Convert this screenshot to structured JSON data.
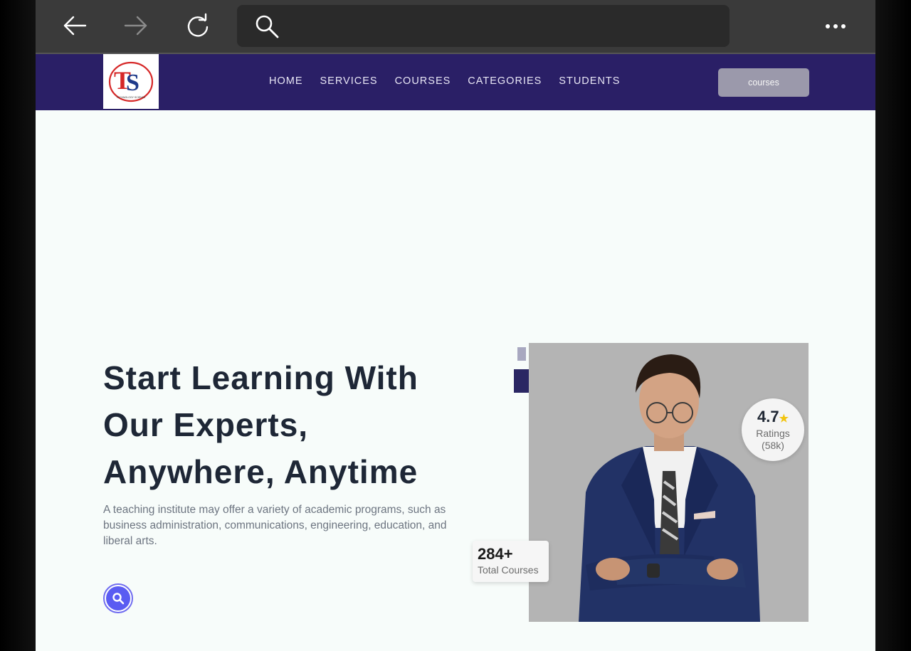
{
  "browser": {
    "back_icon": "arrow-left-icon",
    "forward_icon": "arrow-right-icon",
    "reload_icon": "reload-icon",
    "search_icon": "search-icon",
    "address_value": "",
    "more_icon": "more-horizontal-icon"
  },
  "header": {
    "logo_text": "TS",
    "logo_caption": "TECHNOLOGY SCIENCE",
    "nav": [
      "HOME",
      "SERVICES",
      "COURSES",
      "CATEGORIES",
      "STUDENTS"
    ],
    "cta_label": "courses",
    "bg_color": "#2a1f66"
  },
  "hero": {
    "title_lines": [
      "Start Learning With",
      "Our Experts,",
      "Anywhere, Anytime"
    ],
    "description": "A teaching institute may offer a variety of academic programs, such as business administration, communications, engineering, education, and liberal arts.",
    "search_button_icon": "search-icon",
    "accent_color": "#5a5cf2"
  },
  "rating_badge": {
    "score": "4.7",
    "star": "★",
    "label": "Ratings",
    "count": "(58k)"
  },
  "courses_badge": {
    "count": "284+",
    "label": "Total Courses"
  }
}
